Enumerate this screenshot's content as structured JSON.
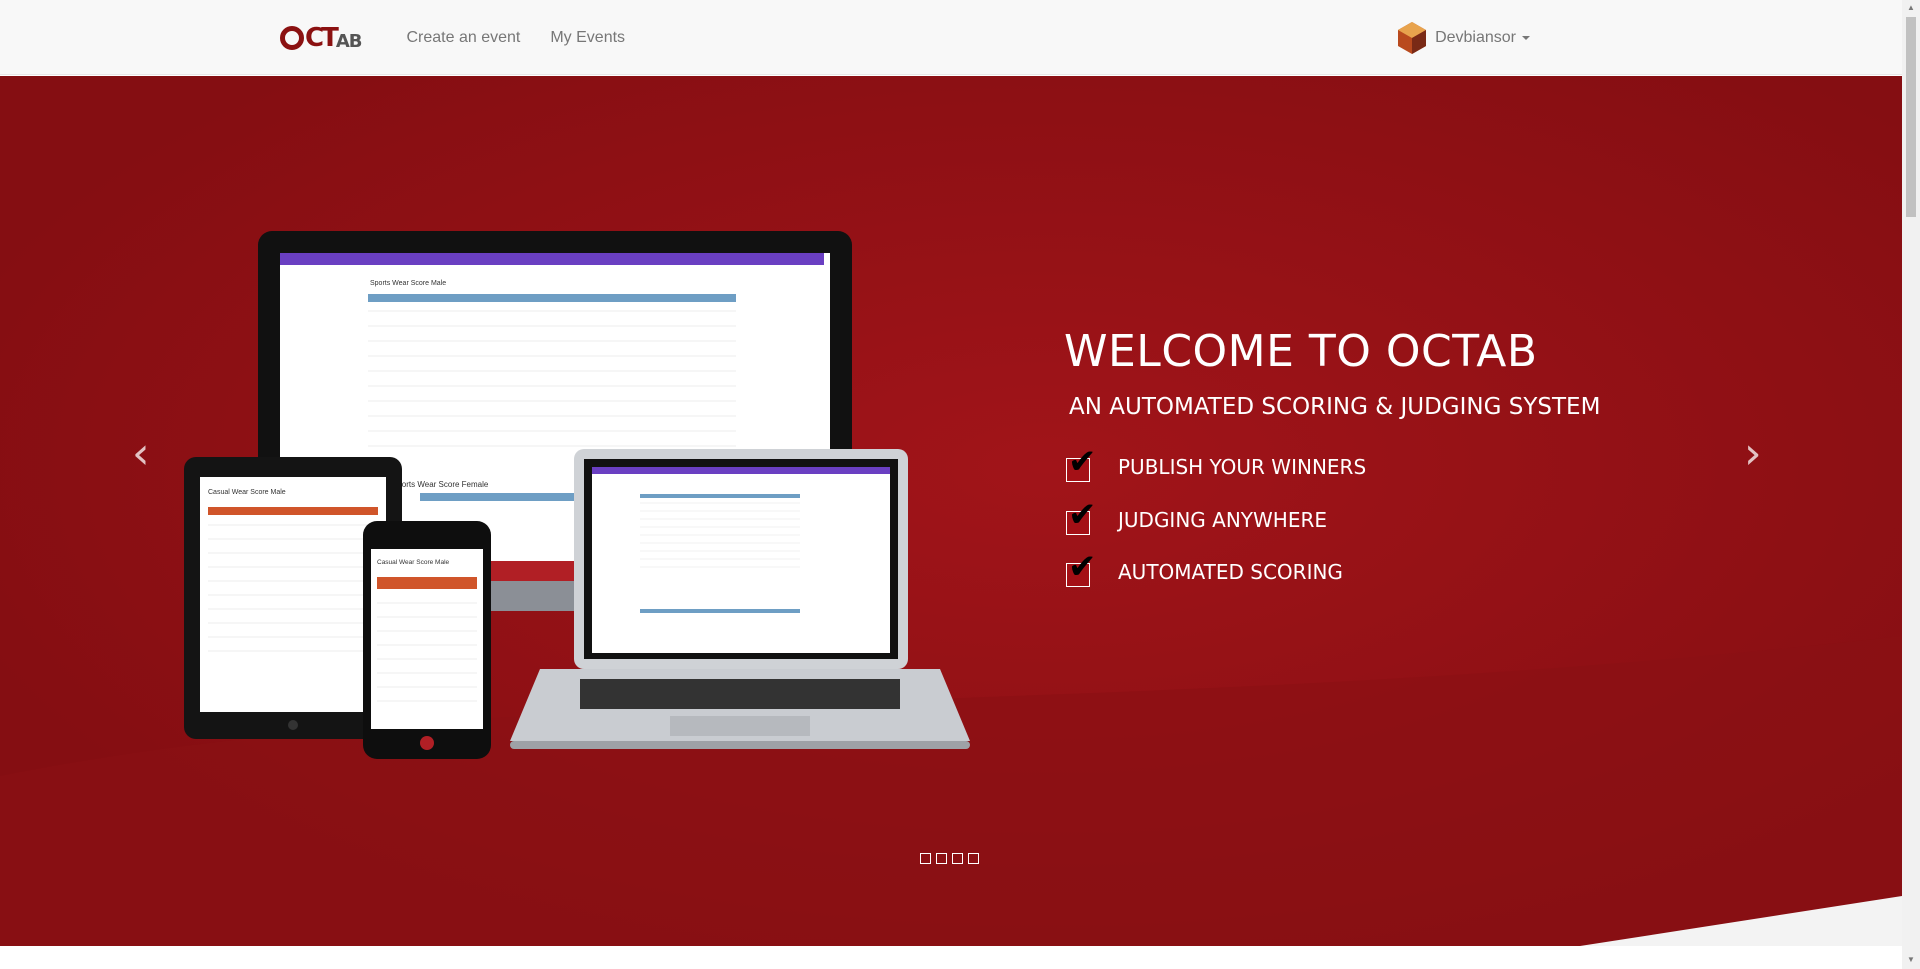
{
  "nav": {
    "logo_text": "OCTAB",
    "links": [
      "Create an event",
      "My Events"
    ],
    "user": "Devbiansor"
  },
  "hero": {
    "title": "WELCOME TO OCTAB",
    "subtitle": "AN AUTOMATED SCORING & JUDGING SYSTEM",
    "features": [
      "PUBLISH YOUR WINNERS",
      "JUDGING ANYWHERE",
      "AUTOMATED SCORING"
    ],
    "slide_count": 4
  },
  "mockup": {
    "desktop_title": "Sports Wear Score Male",
    "desktop_subtitle": "Sports Wear Score Female",
    "tablet_title": "Casual Wear Score Male",
    "phone_title": "Casual Wear Score Male"
  },
  "colors": {
    "brand": "#8e1014",
    "nav_bg": "#f8f8f8",
    "mock_header": "#6a3fc2"
  }
}
